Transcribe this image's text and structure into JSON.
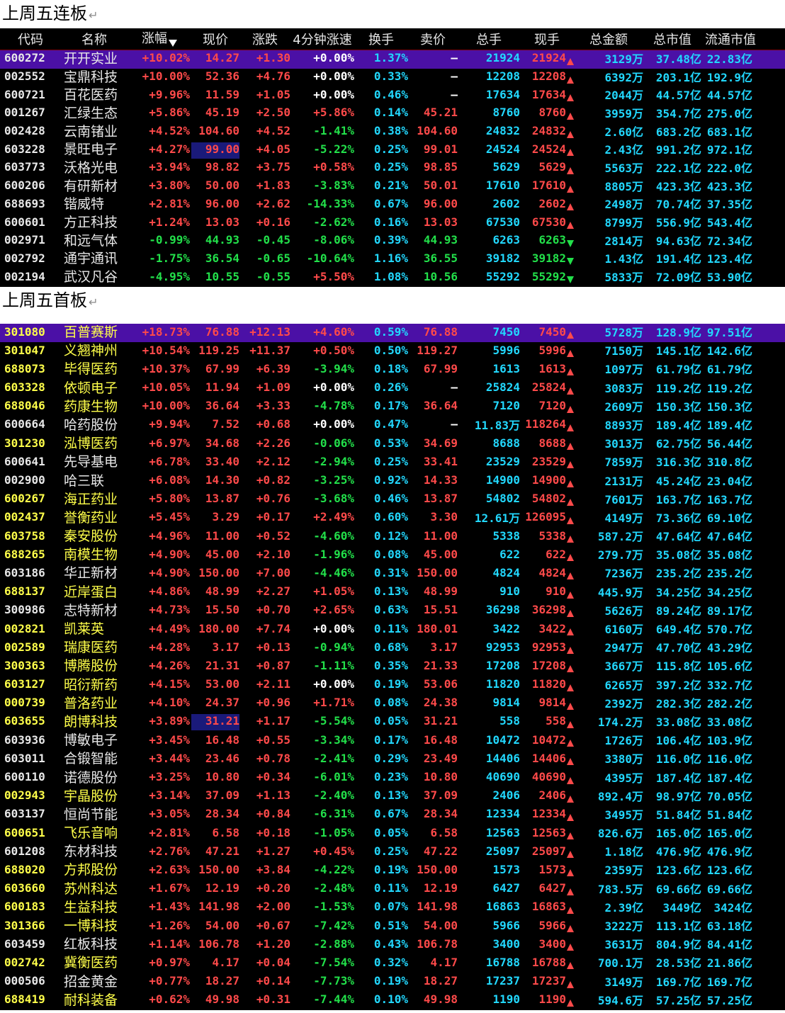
{
  "section1": {
    "title": "上周五连板",
    "ret": "↵"
  },
  "section2": {
    "title": "上周五首板",
    "ret": "↵"
  },
  "headers": {
    "code": "代码",
    "name": "名称",
    "chg": "涨幅",
    "price": "现价",
    "diff": "涨跌",
    "speed": "4分钟涨速",
    "turnover": "换手",
    "ask": "卖价",
    "vol": "总手",
    "cur": "现手",
    "amount": "总金额",
    "mcap": "总市值",
    "fcap": "流通市值"
  },
  "colors": {
    "up": "#ff4a4a",
    "down": "#22e04a",
    "cyan": "#22d8ff",
    "yellow": "#ffff4a",
    "selected": "#4b10a6"
  },
  "board1": [
    {
      "code": "600272",
      "name": "开开实业",
      "chg": "+10.02%",
      "price": "14.27",
      "diff": "+1.30",
      "speed": "+0.00%",
      "turn": "1.37%",
      "ask": "–",
      "vol": "21924",
      "cur": "21924",
      "dir": "up",
      "amt": "3129万",
      "mcap": "37.48亿",
      "fcap": "22.83亿",
      "sel": true
    },
    {
      "code": "002552",
      "name": "宝鼎科技",
      "chg": "+10.00%",
      "price": "52.36",
      "diff": "+4.76",
      "speed": "+0.00%",
      "turn": "0.33%",
      "ask": "–",
      "vol": "12208",
      "cur": "12208",
      "dir": "up",
      "amt": "6392万",
      "mcap": "203.1亿",
      "fcap": "192.9亿"
    },
    {
      "code": "600721",
      "name": "百花医药",
      "chg": "+9.96%",
      "price": "11.59",
      "diff": "+1.05",
      "speed": "+0.00%",
      "turn": "0.46%",
      "ask": "–",
      "vol": "17634",
      "cur": "17634",
      "dir": "up",
      "amt": "2044万",
      "mcap": "44.57亿",
      "fcap": "44.57亿"
    },
    {
      "code": "001267",
      "name": "汇绿生态",
      "chg": "+5.86%",
      "price": "45.19",
      "diff": "+2.50",
      "speed": "+5.86%",
      "turn": "0.14%",
      "ask": "45.21",
      "vol": "8760",
      "cur": "8760",
      "dir": "up",
      "amt": "3959万",
      "mcap": "354.7亿",
      "fcap": "275.0亿"
    },
    {
      "code": "002428",
      "name": "云南锗业",
      "chg": "+4.52%",
      "price": "104.60",
      "diff": "+4.52",
      "speed": "-1.41%",
      "turn": "0.38%",
      "ask": "104.60",
      "vol": "24832",
      "cur": "24832",
      "dir": "up",
      "amt": "2.60亿",
      "mcap": "683.2亿",
      "fcap": "683.1亿"
    },
    {
      "code": "603228",
      "name": "景旺电子",
      "chg": "+4.27%",
      "price": "99.00",
      "diff": "+4.05",
      "speed": "-5.22%",
      "turn": "0.25%",
      "ask": "99.01",
      "vol": "24524",
      "cur": "24524",
      "dir": "up",
      "amt": "2.43亿",
      "mcap": "991.2亿",
      "fcap": "972.1亿",
      "hl": true
    },
    {
      "code": "603773",
      "name": "沃格光电",
      "chg": "+3.94%",
      "price": "98.82",
      "diff": "+3.75",
      "speed": "+0.58%",
      "turn": "0.25%",
      "ask": "98.85",
      "vol": "5629",
      "cur": "5629",
      "dir": "up",
      "amt": "5563万",
      "mcap": "222.1亿",
      "fcap": "222.0亿"
    },
    {
      "code": "600206",
      "name": "有研新材",
      "chg": "+3.80%",
      "price": "50.00",
      "diff": "+1.83",
      "speed": "-3.83%",
      "turn": "0.21%",
      "ask": "50.01",
      "vol": "17610",
      "cur": "17610",
      "dir": "up",
      "amt": "8805万",
      "mcap": "423.3亿",
      "fcap": "423.3亿"
    },
    {
      "code": "688693",
      "name": "锴威特",
      "chg": "+2.81%",
      "price": "96.00",
      "diff": "+2.62",
      "speed": "-14.33%",
      "turn": "0.67%",
      "ask": "96.00",
      "vol": "2602",
      "cur": "2602",
      "dir": "up",
      "amt": "2498万",
      "mcap": "70.74亿",
      "fcap": "37.35亿"
    },
    {
      "code": "600601",
      "name": "方正科技",
      "chg": "+1.24%",
      "price": "13.03",
      "diff": "+0.16",
      "speed": "-2.62%",
      "turn": "0.16%",
      "ask": "13.03",
      "vol": "67530",
      "cur": "67530",
      "dir": "up",
      "amt": "8799万",
      "mcap": "556.9亿",
      "fcap": "543.4亿"
    },
    {
      "code": "002971",
      "name": "和远气体",
      "chg": "-0.99%",
      "price": "44.93",
      "diff": "-0.45",
      "speed": "-8.06%",
      "turn": "0.39%",
      "ask": "44.93",
      "vol": "6263",
      "cur": "6263",
      "dir": "dn",
      "amt": "2814万",
      "mcap": "94.63亿",
      "fcap": "72.34亿"
    },
    {
      "code": "002792",
      "name": "通宇通讯",
      "chg": "-1.75%",
      "price": "36.54",
      "diff": "-0.65",
      "speed": "-10.64%",
      "turn": "1.16%",
      "ask": "36.55",
      "vol": "39182",
      "cur": "39182",
      "dir": "dn",
      "amt": "1.43亿",
      "mcap": "191.4亿",
      "fcap": "123.4亿"
    },
    {
      "code": "002194",
      "name": "武汉凡谷",
      "chg": "-4.95%",
      "price": "10.55",
      "diff": "-0.55",
      "speed": "+5.50%",
      "turn": "1.08%",
      "ask": "10.56",
      "vol": "55292",
      "cur": "55292",
      "dir": "dn",
      "amt": "5833万",
      "mcap": "72.09亿",
      "fcap": "53.90亿"
    }
  ],
  "board2": [
    {
      "code": "301080",
      "name": "百普赛斯",
      "chg": "+18.73%",
      "price": "76.88",
      "diff": "+12.13",
      "speed": "+4.60%",
      "turn": "0.59%",
      "ask": "76.88",
      "vol": "7450",
      "cur": "7450",
      "dir": "up",
      "amt": "5728万",
      "mcap": "128.9亿",
      "fcap": "97.51亿",
      "sel": true,
      "yl": true
    },
    {
      "code": "301047",
      "name": "义翘神州",
      "chg": "+10.54%",
      "price": "119.25",
      "diff": "+11.37",
      "speed": "+0.50%",
      "turn": "0.50%",
      "ask": "119.27",
      "vol": "5996",
      "cur": "5996",
      "dir": "up",
      "amt": "7150万",
      "mcap": "145.1亿",
      "fcap": "142.6亿",
      "yl": true
    },
    {
      "code": "688073",
      "name": "毕得医药",
      "chg": "+10.37%",
      "price": "67.99",
      "diff": "+6.39",
      "speed": "-3.94%",
      "turn": "0.18%",
      "ask": "67.99",
      "vol": "1613",
      "cur": "1613",
      "dir": "up",
      "amt": "1097万",
      "mcap": "61.79亿",
      "fcap": "61.79亿",
      "yl": true
    },
    {
      "code": "603328",
      "name": "依顿电子",
      "chg": "+10.05%",
      "price": "11.94",
      "diff": "+1.09",
      "speed": "+0.00%",
      "turn": "0.26%",
      "ask": "–",
      "vol": "25824",
      "cur": "25824",
      "dir": "up",
      "amt": "3083万",
      "mcap": "119.2亿",
      "fcap": "119.2亿",
      "yl": true
    },
    {
      "code": "688046",
      "name": "药康生物",
      "chg": "+10.00%",
      "price": "36.64",
      "diff": "+3.33",
      "speed": "-4.78%",
      "turn": "0.17%",
      "ask": "36.64",
      "vol": "7120",
      "cur": "7120",
      "dir": "up",
      "amt": "2609万",
      "mcap": "150.3亿",
      "fcap": "150.3亿",
      "yl": true
    },
    {
      "code": "600664",
      "name": "哈药股份",
      "chg": "+9.94%",
      "price": "7.52",
      "diff": "+0.68",
      "speed": "+0.00%",
      "turn": "0.47%",
      "ask": "–",
      "vol": "11.83万",
      "cur": "118264",
      "dir": "up",
      "amt": "8893万",
      "mcap": "189.4亿",
      "fcap": "189.4亿"
    },
    {
      "code": "301230",
      "name": "泓博医药",
      "chg": "+6.97%",
      "price": "34.68",
      "diff": "+2.26",
      "speed": "-0.06%",
      "turn": "0.53%",
      "ask": "34.69",
      "vol": "8688",
      "cur": "8688",
      "dir": "up",
      "amt": "3013万",
      "mcap": "62.75亿",
      "fcap": "56.44亿",
      "yl": true
    },
    {
      "code": "600641",
      "name": "先导基电",
      "chg": "+6.78%",
      "price": "33.40",
      "diff": "+2.12",
      "speed": "-2.94%",
      "turn": "0.25%",
      "ask": "33.41",
      "vol": "23529",
      "cur": "23529",
      "dir": "up",
      "amt": "7859万",
      "mcap": "316.3亿",
      "fcap": "310.8亿"
    },
    {
      "code": "002900",
      "name": "哈三联",
      "chg": "+6.08%",
      "price": "14.30",
      "diff": "+0.82",
      "speed": "-3.25%",
      "turn": "0.92%",
      "ask": "14.33",
      "vol": "14900",
      "cur": "14900",
      "dir": "up",
      "amt": "2131万",
      "mcap": "45.24亿",
      "fcap": "23.04亿"
    },
    {
      "code": "600267",
      "name": "海正药业",
      "chg": "+5.80%",
      "price": "13.87",
      "diff": "+0.76",
      "speed": "-3.68%",
      "turn": "0.46%",
      "ask": "13.87",
      "vol": "54802",
      "cur": "54802",
      "dir": "up",
      "amt": "7601万",
      "mcap": "163.7亿",
      "fcap": "163.7亿",
      "yl": true
    },
    {
      "code": "002437",
      "name": "誉衡药业",
      "chg": "+5.45%",
      "price": "3.29",
      "diff": "+0.17",
      "speed": "+2.49%",
      "turn": "0.60%",
      "ask": "3.30",
      "vol": "12.61万",
      "cur": "126095",
      "dir": "up",
      "amt": "4149万",
      "mcap": "73.36亿",
      "fcap": "69.10亿",
      "yl": true
    },
    {
      "code": "603758",
      "name": "秦安股份",
      "chg": "+4.96%",
      "price": "11.00",
      "diff": "+0.52",
      "speed": "-4.60%",
      "turn": "0.12%",
      "ask": "11.00",
      "vol": "5338",
      "cur": "5338",
      "dir": "up",
      "amt": "587.2万",
      "mcap": "47.64亿",
      "fcap": "47.64亿",
      "yl": true
    },
    {
      "code": "688265",
      "name": "南模生物",
      "chg": "+4.90%",
      "price": "45.00",
      "diff": "+2.10",
      "speed": "-1.96%",
      "turn": "0.08%",
      "ask": "45.00",
      "vol": "622",
      "cur": "622",
      "dir": "up",
      "amt": "279.7万",
      "mcap": "35.08亿",
      "fcap": "35.08亿",
      "yl": true
    },
    {
      "code": "603186",
      "name": "华正新材",
      "chg": "+4.90%",
      "price": "150.00",
      "diff": "+7.00",
      "speed": "-4.46%",
      "turn": "0.31%",
      "ask": "150.00",
      "vol": "4824",
      "cur": "4824",
      "dir": "up",
      "amt": "7236万",
      "mcap": "235.2亿",
      "fcap": "235.2亿"
    },
    {
      "code": "688137",
      "name": "近岸蛋白",
      "chg": "+4.86%",
      "price": "48.99",
      "diff": "+2.27",
      "speed": "+1.05%",
      "turn": "0.13%",
      "ask": "48.99",
      "vol": "910",
      "cur": "910",
      "dir": "up",
      "amt": "445.9万",
      "mcap": "34.25亿",
      "fcap": "34.25亿",
      "yl": true
    },
    {
      "code": "300986",
      "name": "志特新材",
      "chg": "+4.73%",
      "price": "15.50",
      "diff": "+0.70",
      "speed": "+2.65%",
      "turn": "0.63%",
      "ask": "15.51",
      "vol": "36298",
      "cur": "36298",
      "dir": "up",
      "amt": "5626万",
      "mcap": "89.24亿",
      "fcap": "89.17亿"
    },
    {
      "code": "002821",
      "name": "凯莱英",
      "chg": "+4.49%",
      "price": "180.00",
      "diff": "+7.74",
      "speed": "+0.00%",
      "turn": "0.11%",
      "ask": "180.01",
      "vol": "3422",
      "cur": "3422",
      "dir": "up",
      "amt": "6160万",
      "mcap": "649.4亿",
      "fcap": "570.7亿",
      "yl": true
    },
    {
      "code": "002589",
      "name": "瑞康医药",
      "chg": "+4.28%",
      "price": "3.17",
      "diff": "+0.13",
      "speed": "-0.94%",
      "turn": "0.68%",
      "ask": "3.17",
      "vol": "92953",
      "cur": "92953",
      "dir": "up",
      "amt": "2947万",
      "mcap": "47.70亿",
      "fcap": "43.29亿",
      "yl": true
    },
    {
      "code": "300363",
      "name": "博腾股份",
      "chg": "+4.26%",
      "price": "21.31",
      "diff": "+0.87",
      "speed": "-1.11%",
      "turn": "0.35%",
      "ask": "21.33",
      "vol": "17208",
      "cur": "17208",
      "dir": "up",
      "amt": "3667万",
      "mcap": "115.8亿",
      "fcap": "105.6亿",
      "yl": true
    },
    {
      "code": "603127",
      "name": "昭衍新药",
      "chg": "+4.15%",
      "price": "53.00",
      "diff": "+2.11",
      "speed": "+0.00%",
      "turn": "0.19%",
      "ask": "53.06",
      "vol": "11820",
      "cur": "11820",
      "dir": "up",
      "amt": "6265万",
      "mcap": "397.2亿",
      "fcap": "332.7亿",
      "yl": true
    },
    {
      "code": "000739",
      "name": "普洛药业",
      "chg": "+4.10%",
      "price": "24.37",
      "diff": "+0.96",
      "speed": "+1.71%",
      "turn": "0.08%",
      "ask": "24.38",
      "vol": "9814",
      "cur": "9814",
      "dir": "up",
      "amt": "2392万",
      "mcap": "282.3亿",
      "fcap": "282.2亿",
      "yl": true
    },
    {
      "code": "603655",
      "name": "朗博科技",
      "chg": "+3.89%",
      "price": "31.21",
      "diff": "+1.17",
      "speed": "-5.54%",
      "turn": "0.05%",
      "ask": "31.21",
      "vol": "558",
      "cur": "558",
      "dir": "up",
      "amt": "174.2万",
      "mcap": "33.08亿",
      "fcap": "33.08亿",
      "yl": true,
      "hl": true
    },
    {
      "code": "603936",
      "name": "博敏电子",
      "chg": "+3.45%",
      "price": "16.48",
      "diff": "+0.55",
      "speed": "-3.34%",
      "turn": "0.17%",
      "ask": "16.48",
      "vol": "10472",
      "cur": "10472",
      "dir": "up",
      "amt": "1726万",
      "mcap": "106.4亿",
      "fcap": "103.9亿"
    },
    {
      "code": "603011",
      "name": "合锻智能",
      "chg": "+3.44%",
      "price": "23.46",
      "diff": "+0.78",
      "speed": "-2.41%",
      "turn": "0.29%",
      "ask": "23.49",
      "vol": "14406",
      "cur": "14406",
      "dir": "up",
      "amt": "3380万",
      "mcap": "116.0亿",
      "fcap": "116.0亿"
    },
    {
      "code": "600110",
      "name": "诺德股份",
      "chg": "+3.25%",
      "price": "10.80",
      "diff": "+0.34",
      "speed": "-6.01%",
      "turn": "0.23%",
      "ask": "10.80",
      "vol": "40690",
      "cur": "40690",
      "dir": "up",
      "amt": "4395万",
      "mcap": "187.4亿",
      "fcap": "187.4亿"
    },
    {
      "code": "002943",
      "name": "宇晶股份",
      "chg": "+3.14%",
      "price": "37.09",
      "diff": "+1.13",
      "speed": "-2.40%",
      "turn": "0.13%",
      "ask": "37.09",
      "vol": "2406",
      "cur": "2406",
      "dir": "up",
      "amt": "892.4万",
      "mcap": "98.97亿",
      "fcap": "70.05亿",
      "yl": true
    },
    {
      "code": "603137",
      "name": "恒尚节能",
      "chg": "+3.05%",
      "price": "28.34",
      "diff": "+0.84",
      "speed": "-6.31%",
      "turn": "0.67%",
      "ask": "28.34",
      "vol": "12334",
      "cur": "12334",
      "dir": "up",
      "amt": "3495万",
      "mcap": "51.84亿",
      "fcap": "51.84亿"
    },
    {
      "code": "600651",
      "name": "飞乐音响",
      "chg": "+2.81%",
      "price": "6.58",
      "diff": "+0.18",
      "speed": "-1.05%",
      "turn": "0.05%",
      "ask": "6.58",
      "vol": "12563",
      "cur": "12563",
      "dir": "up",
      "amt": "826.6万",
      "mcap": "165.0亿",
      "fcap": "165.0亿",
      "yl": true
    },
    {
      "code": "601208",
      "name": "东材科技",
      "chg": "+2.76%",
      "price": "47.21",
      "diff": "+1.27",
      "speed": "+0.45%",
      "turn": "0.25%",
      "ask": "47.22",
      "vol": "25097",
      "cur": "25097",
      "dir": "up",
      "amt": "1.18亿",
      "mcap": "476.9亿",
      "fcap": "476.9亿"
    },
    {
      "code": "688020",
      "name": "方邦股份",
      "chg": "+2.63%",
      "price": "150.00",
      "diff": "+3.84",
      "speed": "-4.22%",
      "turn": "0.19%",
      "ask": "150.00",
      "vol": "1573",
      "cur": "1573",
      "dir": "up",
      "amt": "2359万",
      "mcap": "123.6亿",
      "fcap": "123.6亿",
      "yl": true
    },
    {
      "code": "603660",
      "name": "苏州科达",
      "chg": "+1.67%",
      "price": "12.19",
      "diff": "+0.20",
      "speed": "-2.48%",
      "turn": "0.11%",
      "ask": "12.19",
      "vol": "6427",
      "cur": "6427",
      "dir": "up",
      "amt": "783.5万",
      "mcap": "69.66亿",
      "fcap": "69.66亿",
      "yl": true
    },
    {
      "code": "600183",
      "name": "生益科技",
      "chg": "+1.43%",
      "price": "141.98",
      "diff": "+2.00",
      "speed": "-1.53%",
      "turn": "0.07%",
      "ask": "141.98",
      "vol": "16863",
      "cur": "16863",
      "dir": "up",
      "amt": "2.39亿",
      "mcap": "3449亿",
      "fcap": "3424亿",
      "yl": true
    },
    {
      "code": "301366",
      "name": "一博科技",
      "chg": "+1.26%",
      "price": "54.00",
      "diff": "+0.67",
      "speed": "-7.42%",
      "turn": "0.51%",
      "ask": "54.00",
      "vol": "5966",
      "cur": "5966",
      "dir": "up",
      "amt": "3222万",
      "mcap": "113.1亿",
      "fcap": "63.18亿",
      "yl": true
    },
    {
      "code": "603459",
      "name": "红板科技",
      "chg": "+1.14%",
      "price": "106.78",
      "diff": "+1.20",
      "speed": "-2.88%",
      "turn": "0.43%",
      "ask": "106.78",
      "vol": "3400",
      "cur": "3400",
      "dir": "up",
      "amt": "3631万",
      "mcap": "804.9亿",
      "fcap": "84.41亿"
    },
    {
      "code": "002742",
      "name": "冀衡医药",
      "chg": "+0.97%",
      "price": "4.17",
      "diff": "+0.04",
      "speed": "-7.54%",
      "turn": "0.32%",
      "ask": "4.17",
      "vol": "16788",
      "cur": "16788",
      "dir": "up",
      "amt": "700.1万",
      "mcap": "28.53亿",
      "fcap": "21.86亿",
      "yl": true
    },
    {
      "code": "000506",
      "name": "招金黄金",
      "chg": "+0.77%",
      "price": "18.27",
      "diff": "+0.14",
      "speed": "-7.73%",
      "turn": "0.19%",
      "ask": "18.27",
      "vol": "17237",
      "cur": "17237",
      "dir": "up",
      "amt": "3149万",
      "mcap": "169.7亿",
      "fcap": "169.7亿"
    },
    {
      "code": "688419",
      "name": "耐科装备",
      "chg": "+0.62%",
      "price": "49.98",
      "diff": "+0.31",
      "speed": "-7.44%",
      "turn": "0.10%",
      "ask": "49.98",
      "vol": "1190",
      "cur": "1190",
      "dir": "up",
      "amt": "594.6万",
      "mcap": "57.25亿",
      "fcap": "57.25亿",
      "yl": true
    }
  ]
}
